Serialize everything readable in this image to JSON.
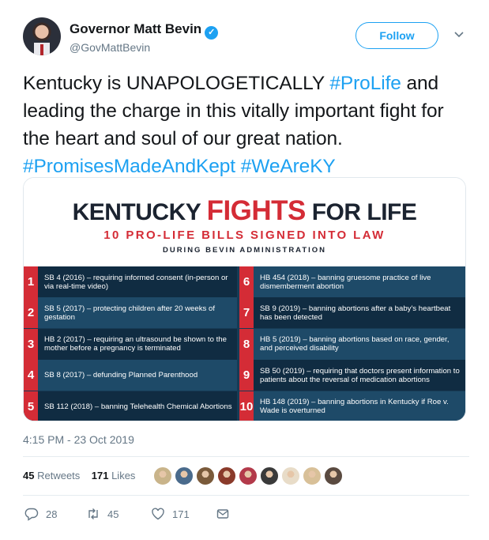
{
  "tweet": {
    "author_name": "Governor Matt Bevin",
    "verified_icon": "verified-badge-icon",
    "handle": "@GovMattBevin",
    "follow_label": "Follow",
    "menu_icon": "chevron-down-icon",
    "text_segments": [
      {
        "text": "Kentucky is UNAPOLOGETICALLY ",
        "hashtag": false
      },
      {
        "text": "#ProLife",
        "hashtag": true
      },
      {
        "text": " and leading the charge in this vitally important fight for the heart and soul of our great nation. ",
        "hashtag": false
      },
      {
        "text": "#PromisesMadeAndKept",
        "hashtag": true
      },
      {
        "text": " ",
        "hashtag": false
      },
      {
        "text": "#WeAreKY",
        "hashtag": true
      }
    ],
    "timestamp": "4:15 PM - 23 Oct 2019"
  },
  "infographic": {
    "title_before": "KENTUCKY ",
    "title_highlight": "FIGHTS",
    "title_after": " FOR LIFE",
    "subtitle": "10 PRO-LIFE BILLS SIGNED INTO LAW",
    "caption": "DURING BEVIN ADMINISTRATION",
    "bills": [
      {
        "num": "1",
        "text": "SB 4 (2016) – requiring informed consent (in-person or via real-time video)"
      },
      {
        "num": "2",
        "text": "SB 5 (2017) – protecting children after 20 weeks of gestation"
      },
      {
        "num": "3",
        "text": "HB 2 (2017) – requiring an ultrasound be shown to the mother before a pregnancy is terminated"
      },
      {
        "num": "4",
        "text": "SB 8 (2017) – defunding Planned Parenthood"
      },
      {
        "num": "5",
        "text": "SB 112 (2018) – banning Telehealth Chemical Abortions"
      },
      {
        "num": "6",
        "text": "HB 454 (2018) – banning gruesome practice of live dismemberment abortion"
      },
      {
        "num": "7",
        "text": "SB 9 (2019) – banning abortions after a baby's heartbeat has been detected"
      },
      {
        "num": "8",
        "text": "HB 5 (2019) – banning abortions based on race, gender, and perceived disability"
      },
      {
        "num": "9",
        "text": "SB 50 (2019) – requiring that doctors present information to patients about the reversal of medication abortions"
      },
      {
        "num": "10",
        "text": "HB 148 (2019) – banning abortions in Kentucky if Roe v. Wade is overturned"
      }
    ],
    "colors": {
      "red": "#d42c36",
      "navy": "#173b55",
      "ink": "#1b2330"
    }
  },
  "stats": {
    "retweets_count": "45",
    "retweets_label": "Retweets",
    "likes_count": "171",
    "likes_label": "Likes",
    "liker_avatar_colors": [
      "#c9b48a",
      "#4a6b8c",
      "#7a5a3a",
      "#8a3a2a",
      "#b33a4a",
      "#3a3a3a",
      "#e8dcc8",
      "#d8c098",
      "#5a4a40"
    ]
  },
  "actions": {
    "reply_icon": "reply-icon",
    "reply_count": "28",
    "retweet_icon": "retweet-icon",
    "retweet_count": "45",
    "like_icon": "heart-icon",
    "like_count": "171",
    "message_icon": "direct-message-icon"
  },
  "accent_color": "#1da1f2"
}
